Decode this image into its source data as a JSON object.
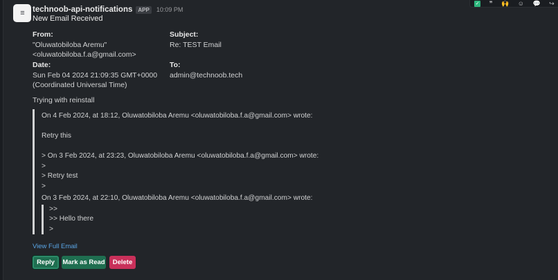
{
  "message": {
    "sender": "technoob-api-notifications",
    "badge": "APP",
    "time": "10:09 PM",
    "title": "New Email Received"
  },
  "email": {
    "from_label": "From:",
    "from_name": "\"Oluwatobiloba Aremu\"",
    "from_email": "<oluwatobiloba.f.a@gmail.com>",
    "subject_label": "Subject:",
    "subject": "Re: TEST Email",
    "date_label": "Date:",
    "date": "Sun Feb 04 2024 21:09:35 GMT+0000",
    "date_tz": "(Coordinated Universal Time)",
    "to_label": "To:",
    "to": "admin@technoob.tech",
    "body": "Trying with reinstall"
  },
  "quoted": {
    "line1": "On 4 Feb 2024, at 18:12, Oluwatobiloba Aremu <oluwatobiloba.f.a@gmail.com> wrote:",
    "line2": "Retry this",
    "line3": "> On 3 Feb 2024, at 23:23, Oluwatobiloba Aremu <oluwatobiloba.f.a@gmail.com> wrote:",
    "line4": ">",
    "line5": "> Retry test",
    "line6": ">",
    "line7": "On 3 Feb 2024, at 22:10, Oluwatobiloba Aremu <oluwatobiloba.f.a@gmail.com> wrote:",
    "nested": {
      "line1": ">>",
      "line2": ">> Hello there",
      "line3": ">"
    }
  },
  "actions": {
    "view_full": "View Full Email",
    "reply": "Reply",
    "mark_read": "Mark as Read",
    "delete": "Delete"
  },
  "toolbar": {
    "icons": [
      "check-icon",
      "quote-icon",
      "raised-hands-icon",
      "add-reaction-icon",
      "reply-thread-icon",
      "share-icon"
    ],
    "check_glyph": "✓",
    "quote_glyph": "❞",
    "hands_glyph": "🙌",
    "reaction_glyph": "☺",
    "thread_glyph": "💬",
    "share_glyph": "↪"
  },
  "colors": {
    "background": "#222529",
    "primary_button": "#1f6e50",
    "danger_button": "#c9305a",
    "link": "#5aa6e6"
  }
}
